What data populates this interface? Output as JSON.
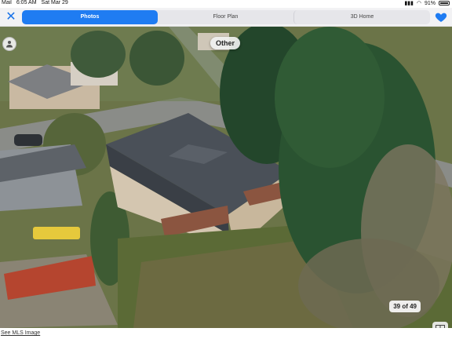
{
  "status_bar": {
    "carrier": "Mail",
    "time": "6:05 AM",
    "date": "Sat Mar 29",
    "battery": "91%"
  },
  "nav": {
    "tabs": [
      {
        "label": "Photos",
        "active": true
      },
      {
        "label": "Floor Plan",
        "active": false
      },
      {
        "label": "3D Home",
        "active": false
      }
    ],
    "accent_color": "#1f7cf2"
  },
  "photo": {
    "tag_label": "Other",
    "counter": "39 of 49"
  },
  "footer": {
    "link_label": "See MLS Image"
  }
}
